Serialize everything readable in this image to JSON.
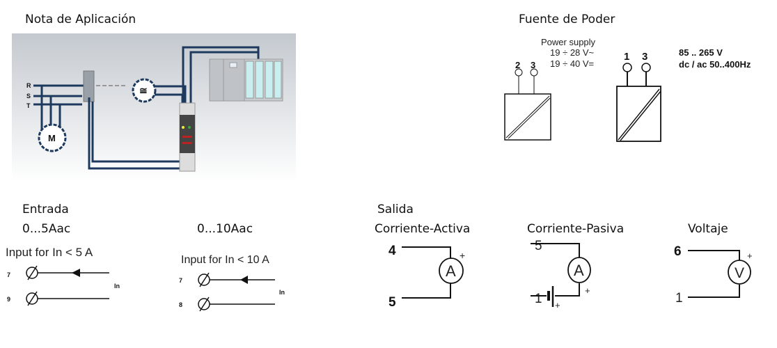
{
  "application_note": {
    "title": "Nota de Aplicación",
    "phases": [
      "R",
      "S",
      "T"
    ],
    "motor_label": "M",
    "supply_symbol": "≅"
  },
  "power_supply": {
    "title": "Fuente de Poder",
    "low": {
      "heading": "Power supply",
      "line1": "19 ÷ 28 V~",
      "line2": "19 ÷ 40 V=",
      "terminals": [
        "2",
        "3"
      ]
    },
    "high": {
      "line1": "85 .. 265 V",
      "line2": "dc / ac 50..400Hz",
      "terminals": [
        "1",
        "3"
      ]
    }
  },
  "input": {
    "title": "Entrada",
    "variants": [
      {
        "range": "0...5Aac",
        "caption": "Input for In < 5 A",
        "terminals": [
          "7",
          "9"
        ],
        "current_label": "In"
      },
      {
        "range": "0...10Aac",
        "caption": "Input for In < 10 A",
        "terminals": [
          "7",
          "8"
        ],
        "current_label": "In"
      }
    ]
  },
  "output": {
    "title": "Salida",
    "active": {
      "label": "Corriente-Activa",
      "top": "4",
      "bottom": "5",
      "meter": "A",
      "plus": "+"
    },
    "passive": {
      "label": "Corriente-Pasiva",
      "top": "5",
      "bottom": "1",
      "meter": "A",
      "plus": "+"
    },
    "voltage": {
      "label": "Voltaje",
      "top": "6",
      "bottom": "1",
      "meter": "V",
      "plus": "+"
    }
  },
  "colors": {
    "wire": "#1d3a5e",
    "panel_top": "#c9ced4",
    "panel_bottom": "#ffffff"
  }
}
